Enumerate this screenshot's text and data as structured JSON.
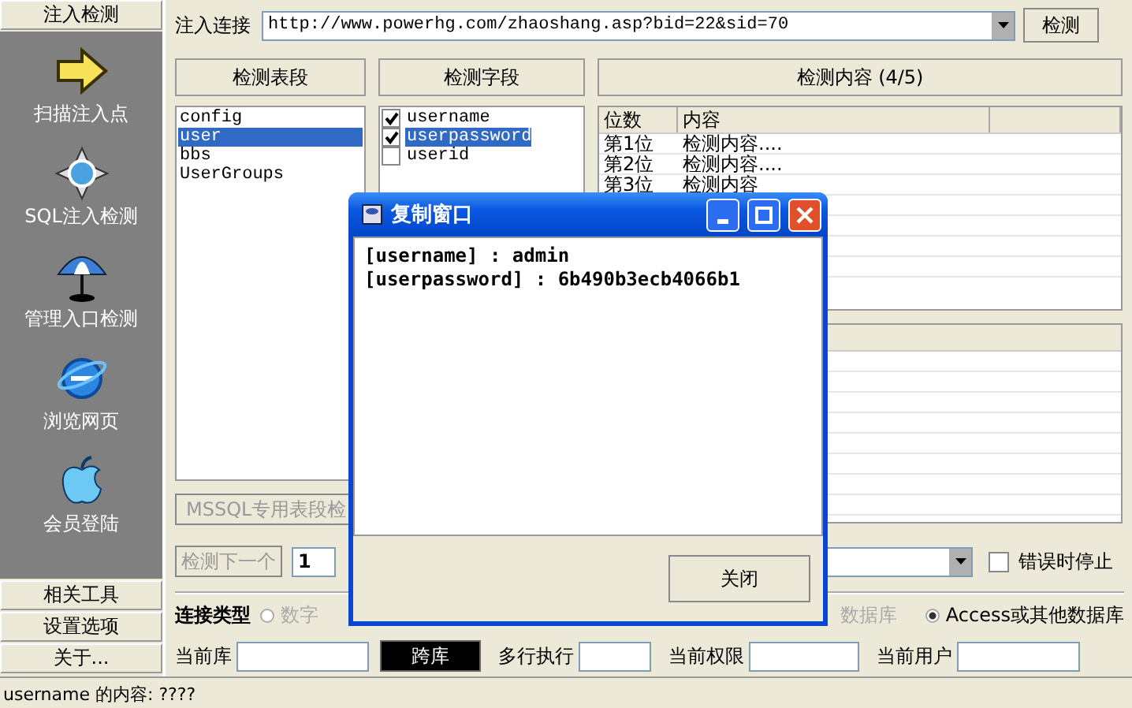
{
  "sidebar": {
    "top_button": "注入检测",
    "items": [
      {
        "label": "扫描注入点",
        "kind": "arrow"
      },
      {
        "label": "SQL注入检测",
        "kind": "compass"
      },
      {
        "label": "管理入口检测",
        "kind": "umbrella"
      },
      {
        "label": "浏览网页",
        "kind": "globe"
      },
      {
        "label": "会员登陆",
        "kind": "apple"
      }
    ],
    "bottom_buttons": [
      "相关工具",
      "设置选项",
      "关于..."
    ]
  },
  "url_bar": {
    "label": "注入连接",
    "value": "http://www.powerhg.com/zhaoshang.asp?bid=22&sid=70",
    "button": "检测"
  },
  "tables": {
    "header": "检测表段",
    "items": [
      {
        "label": "config",
        "selected": false
      },
      {
        "label": "user",
        "selected": true
      },
      {
        "label": "bbs",
        "selected": false
      },
      {
        "label": "UserGroups",
        "selected": false
      }
    ],
    "mssql_button": "MSSQL专用表段检"
  },
  "fields": {
    "header": "检测字段",
    "items": [
      {
        "label": "username",
        "checked": true,
        "selected": false
      },
      {
        "label": "userpassword",
        "checked": true,
        "selected": true
      },
      {
        "label": "userid",
        "checked": false,
        "selected": false
      }
    ]
  },
  "content": {
    "header": "检测内容 (4/5)",
    "columns": [
      "位数",
      "内容"
    ],
    "rows": [
      {
        "position": "第1位",
        "content": "检测内容...."
      },
      {
        "position": "第2位",
        "content": "检测内容...."
      },
      {
        "position": "第3位",
        "content": "检测内容"
      }
    ]
  },
  "controls": {
    "next_button": "检测下一个",
    "count": "1",
    "stop_on_error": {
      "label": "错误时停止",
      "checked": false
    }
  },
  "connection": {
    "label": "连接类型",
    "options": [
      {
        "label": "数字",
        "selected": false
      },
      {
        "label": "数据库"
      },
      {
        "label": "Access或其他数据库",
        "selected": true
      }
    ]
  },
  "info": {
    "current_db": "当前库",
    "cross_db_button": "跨库",
    "multi_exec": "多行执行",
    "privilege": "当前权限",
    "current_user": "当前用户"
  },
  "dialog": {
    "title": "复制窗口",
    "lines": [
      "[username] : admin",
      "[userpassword] : 6b490b3ecb4066b1"
    ],
    "button": "关闭"
  },
  "status_bar": "username 的内容: ????"
}
